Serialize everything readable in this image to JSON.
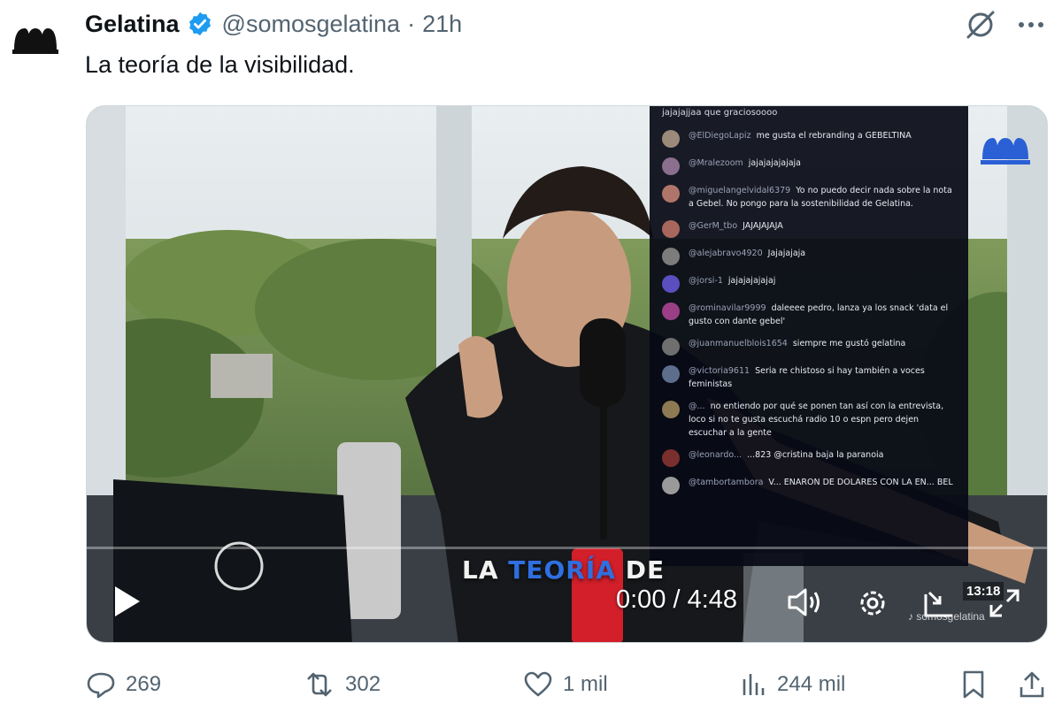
{
  "author": {
    "display_name": "Gelatina",
    "handle": "@somosgelatina",
    "separator": "·",
    "time": "21h",
    "verified_icon": "verified-badge-icon",
    "avatar_icon": "gelatina-logo-icon"
  },
  "tweet": {
    "text": "La teoría de la visibilidad."
  },
  "video": {
    "caption_part1": "LA ",
    "caption_highlight": "TEORÍA",
    "caption_part2": " DE",
    "time": "0:00 / 4:48",
    "progress": 0,
    "clock": "13:18",
    "watermark": "♪ somosgelatina",
    "chat_top": "jajajajjaa que graciosoooo",
    "chat": [
      {
        "user": "@ElDiegoLapiz",
        "text": "me gusta el rebranding a GEBELTINA"
      },
      {
        "user": "@Mralezoom",
        "text": "jajajajajajaja"
      },
      {
        "user": "@miguelangelvidal6379",
        "text": "Yo no puedo decir nada sobre la nota a Gebel. No pongo para la sostenibilidad de Gelatina."
      },
      {
        "user": "@GerM_tbo",
        "text": "JAJAJAJAJA"
      },
      {
        "user": "@alejabravo4920",
        "text": "Jajajajaja"
      },
      {
        "user": "@jorsi-1",
        "text": "jajajajajajaj"
      },
      {
        "user": "@rominavilar9999",
        "text": "daleeee pedro, lanza ya los snack 'data el gusto con dante gebel'"
      },
      {
        "user": "@juanmanuelblois1654",
        "text": "siempre me gustó gelatina"
      },
      {
        "user": "@victoria9611",
        "text": "Seria re chistoso si hay también a voces feministas"
      },
      {
        "user": "@...",
        "text": "no entiendo por qué se ponen tan así con la entrevista, loco si no te gusta escuchá radio 10 o espn pero dejen escuchar a la gente"
      },
      {
        "user": "@leonardo...",
        "text": "...823 @cristina baja la paranoia"
      },
      {
        "user": "@tambortambora",
        "text": "V... ENARON DE DOLARES CON LA EN... BEL"
      }
    ]
  },
  "actions": {
    "replies": "269",
    "reposts": "302",
    "likes": "1 mil",
    "views": "244 mil"
  },
  "colors": {
    "text_primary": "#0f1419",
    "text_secondary": "#536471",
    "verified_blue": "#1d9bf0",
    "caption_highlight": "#2f6fe0"
  }
}
